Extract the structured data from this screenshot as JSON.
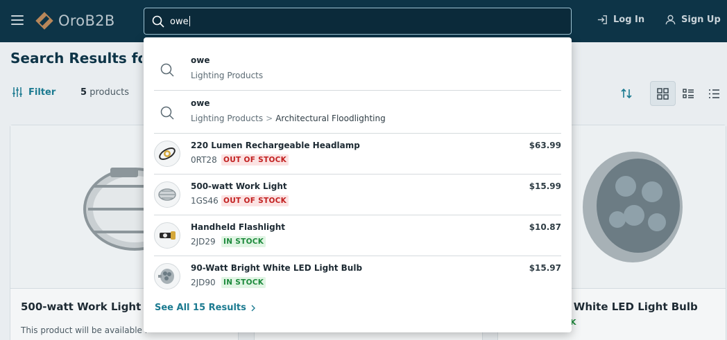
{
  "header": {
    "logo_text": "OroB2B",
    "login_label": "Log In",
    "signup_label": "Sign Up"
  },
  "search": {
    "value": "owe"
  },
  "page": {
    "title": "Search Results for",
    "filter_label": "Filter",
    "count_number": "5",
    "count_unit": "products"
  },
  "cards": [
    {
      "title": "500-watt Work Light",
      "note": "This product will be available l"
    },
    {
      "title": "ght White LED Light Bulb",
      "badge": "K"
    }
  ],
  "dropdown": {
    "suggestions": [
      {
        "query": "owe",
        "category": "Lighting Products",
        "subcategory": ""
      },
      {
        "query": "owe",
        "category": "Lighting Products",
        "separator": ">",
        "subcategory": "Architectural Floodlighting"
      }
    ],
    "products": [
      {
        "name": "220 Lumen Rechargeable Headlamp",
        "sku": "0RT28",
        "status": "OUT OF STOCK",
        "price": "$63.99"
      },
      {
        "name": "500-watt Work Light",
        "sku": "1GS46",
        "status": "OUT OF STOCK",
        "price": "$15.99"
      },
      {
        "name": "Handheld Flashlight",
        "sku": "2JD29",
        "status": "IN STOCK",
        "price": "$10.87"
      },
      {
        "name": "90-Watt Bright White LED Light Bulb",
        "sku": "2JD90",
        "status": "IN STOCK",
        "price": "$15.97"
      }
    ],
    "see_all_label": "See All 15 Results"
  },
  "colors": {
    "header_bg": "#0d3447",
    "accent": "#1b7a90",
    "out_of_stock": "#c22020",
    "in_stock": "#1d8a3c"
  }
}
